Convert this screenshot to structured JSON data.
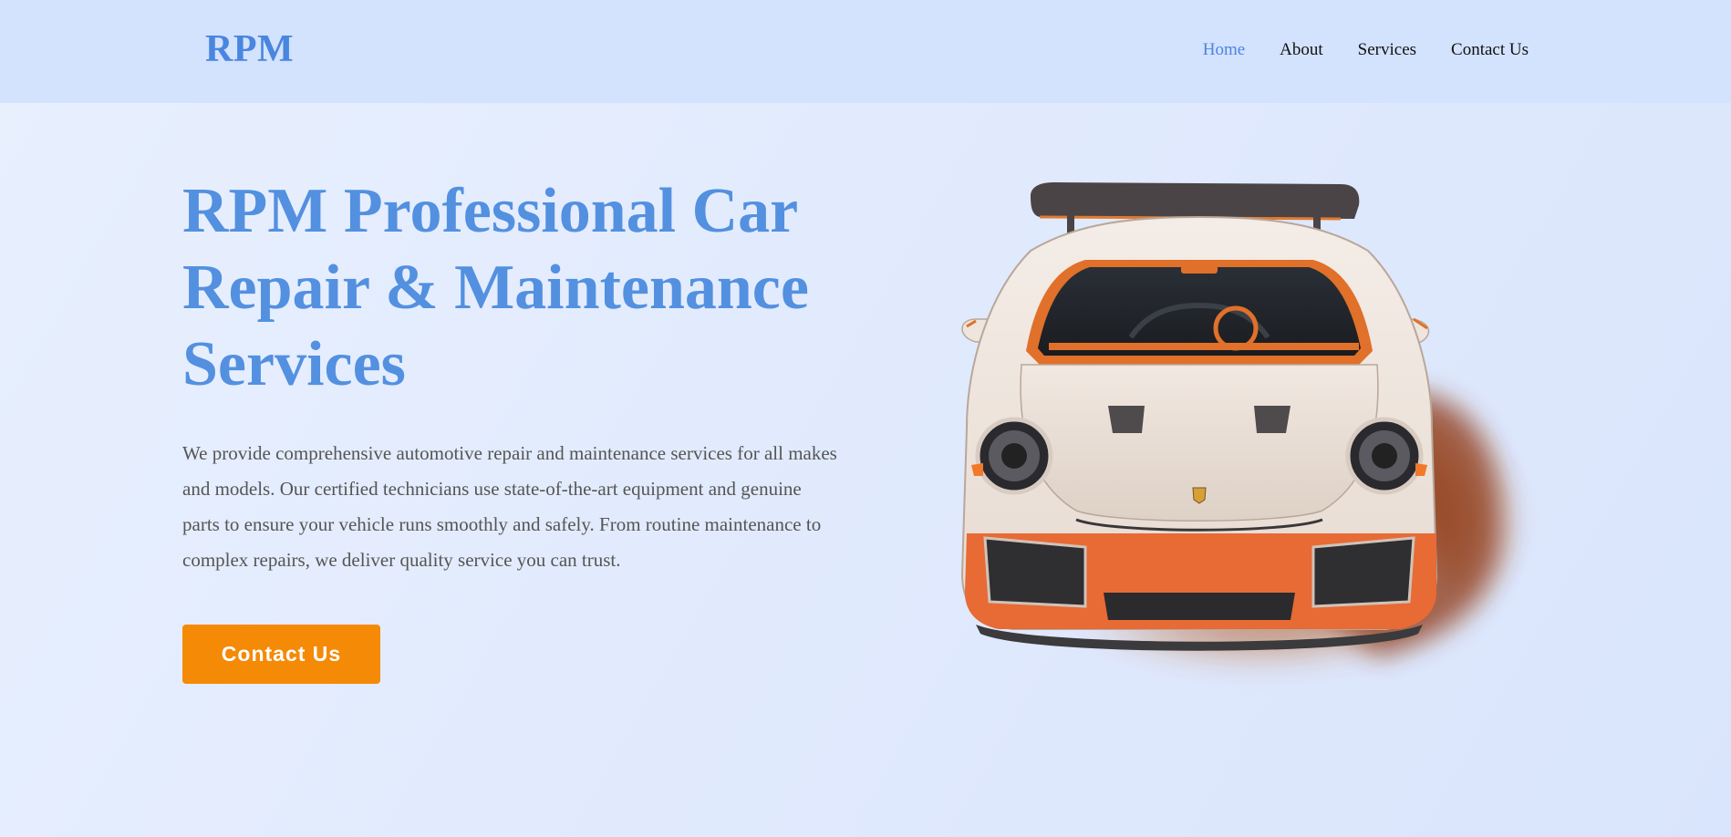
{
  "brand": {
    "logo_text": "RPM",
    "accent_color": "#4a86e0",
    "cta_color": "#f58a07",
    "header_bg": "#d3e2fd"
  },
  "nav": {
    "items": [
      {
        "label": "Home",
        "active": true
      },
      {
        "label": "About",
        "active": false
      },
      {
        "label": "Services",
        "active": false
      },
      {
        "label": "Contact Us",
        "active": false
      }
    ]
  },
  "hero": {
    "title": "RPM Professional Car Repair & Maintenance Services",
    "description": "We provide comprehensive automotive repair and maintenance services for all makes and models. Our certified technicians use state-of-the-art equipment and genuine parts to ensure your vehicle runs smoothly and safely. From routine maintenance to complex repairs, we deliver quality service you can trust.",
    "cta_label": "Contact Us",
    "image": "sports-car-front-view"
  }
}
